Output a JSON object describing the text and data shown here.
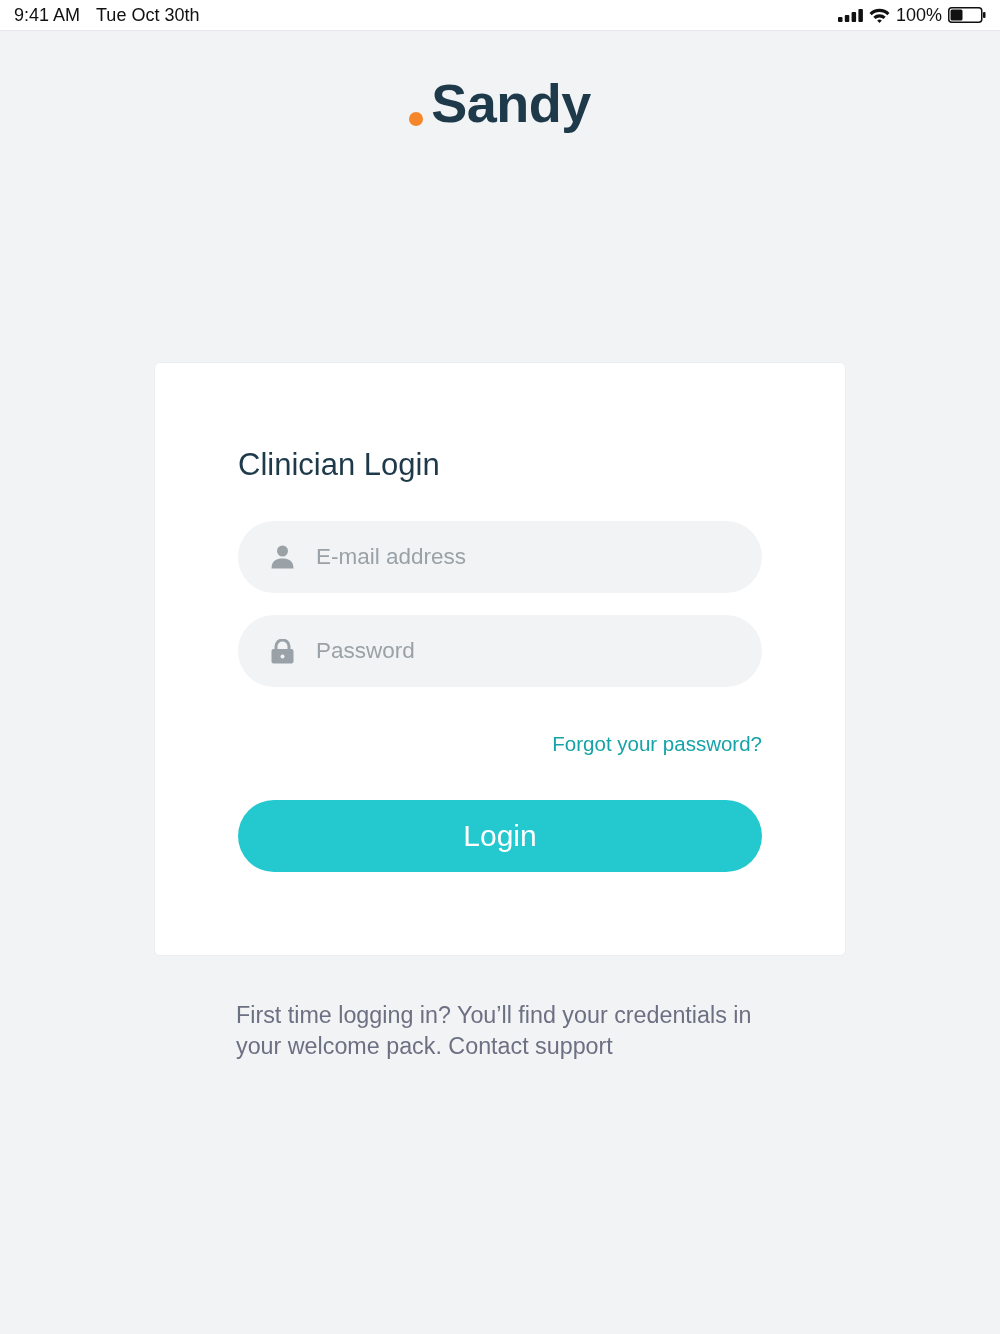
{
  "status_bar": {
    "time": "9:41 AM",
    "date": "Tue Oct 30th",
    "battery": "100%"
  },
  "logo": {
    "text": "Sandy"
  },
  "login_card": {
    "title": "Clinician Login",
    "fields": [
      {
        "kind": "email",
        "placeholder": "E-mail address"
      },
      {
        "kind": "password",
        "placeholder": "Password"
      }
    ],
    "forgot_link": "Forgot your password?",
    "login_button": "Login"
  },
  "footer": {
    "text": "First time logging in? You’ll find your credentials in your welcome pack. Contact support"
  }
}
